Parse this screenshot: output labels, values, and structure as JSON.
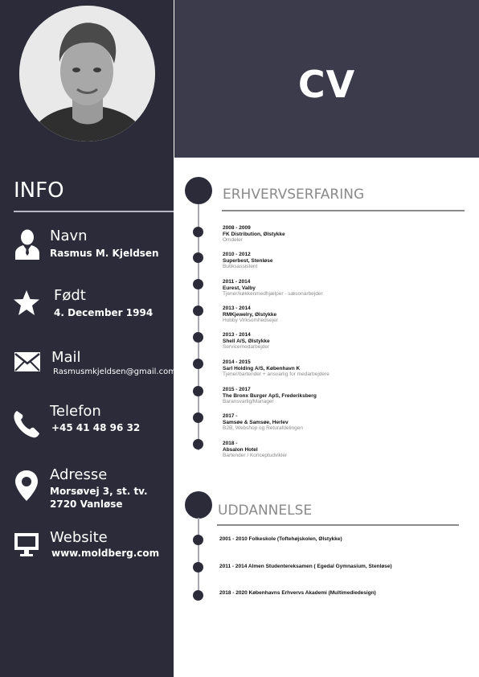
{
  "header": {
    "title": "CV"
  },
  "info": {
    "title": "INFO",
    "items": [
      {
        "icon": "person-icon",
        "label": "Navn",
        "value": "Rasmus M. Kjeldsen"
      },
      {
        "icon": "star-icon",
        "label": "Født",
        "value": "4. December 1994"
      },
      {
        "icon": "mail-icon",
        "label": "Mail",
        "value": "Rasmusmkjeldsen@gmail.com"
      },
      {
        "icon": "phone-icon",
        "label": "Telefon",
        "value": "+45 41 48 96 32"
      },
      {
        "icon": "location-pin-icon",
        "label": "Adresse",
        "value": "Morsøvej 3, st. tv.",
        "value2": "2720 Vanløse"
      },
      {
        "icon": "monitor-icon",
        "label": "Website",
        "value": "www.moldberg.com"
      }
    ]
  },
  "experience": {
    "title": "ERHVERVSERFARING",
    "items": [
      {
        "years": "2008 - 2009",
        "company": "FK Distribution, Ølstykke",
        "role": "Omdeler"
      },
      {
        "years": "2010 - 2012",
        "company": "Superbest, Stenløse",
        "role": "Butiksassistent"
      },
      {
        "years": "2011 - 2014",
        "company": "Eurest, Valby",
        "role": "Tjener/køkkenmedhjælper - sæsonarbejder"
      },
      {
        "years": "2013 - 2014",
        "company": "RMKjewelry, Ølstykke",
        "role": "Hobby Virksomhedsejer"
      },
      {
        "years": "2013 - 2014",
        "company": "Shell A/S, Ølstykke",
        "role": "Servicemedarbejder"
      },
      {
        "years": "2014 - 2015",
        "company": "Sarl Holding A/S, København K",
        "role": "Tjener/bartender + ansvarlig for medarbejdere"
      },
      {
        "years": "2015 - 2017",
        "company": "The Bronx Burger ApS, Frederiksberg",
        "role": "Baransvarlig/Manager"
      },
      {
        "years": "2017 -",
        "company": "Samsøe & Samsøe, Herlev",
        "role": "B2B, Webshop og Returafdelingen"
      },
      {
        "years": "2018 -",
        "company": "Absalon Hotel",
        "role": "Bartender / Konceptudvikler"
      }
    ]
  },
  "education": {
    "title": "UDDANNELSE",
    "items": [
      {
        "text": "2001 - 2010 Folkeskole (Toftehøjskolen, Ølstykke)"
      },
      {
        "text": "2011 - 2014 Almen Studentereksamen ( Egedal Gymnasium, Stenløse)"
      },
      {
        "text": "2018 - 2020 Københavns Erhvervs Akademi (Multimediedesign)"
      }
    ]
  },
  "colors": {
    "sidebar": "#2b2b3a",
    "header": "#3b3b4b",
    "accent_gray": "#8a8a8a"
  }
}
